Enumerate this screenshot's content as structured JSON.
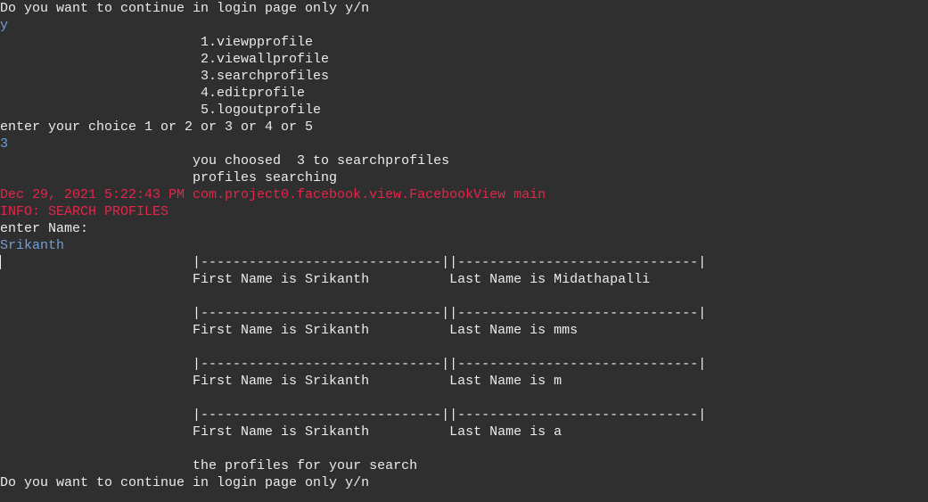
{
  "colors": {
    "background": "#2f2f2f",
    "stdout": "#ebebeb",
    "stdin": "#6f9fd8",
    "stderr": "#e4264a"
  },
  "lines": [
    {
      "text": "Do you want to continue in login page only y/n",
      "type": "out"
    },
    {
      "text": "y",
      "type": "in"
    },
    {
      "text": "                         1.viewpprofile",
      "type": "out"
    },
    {
      "text": "                         2.viewallprofile",
      "type": "out"
    },
    {
      "text": "                         3.searchprofiles",
      "type": "out"
    },
    {
      "text": "                         4.editprofile",
      "type": "out"
    },
    {
      "text": "                         5.logoutprofile",
      "type": "out"
    },
    {
      "text": "enter your choice 1 or 2 or 3 or 4 or 5",
      "type": "out"
    },
    {
      "text": "3",
      "type": "in"
    },
    {
      "text": "                        you choosed  3 to searchprofiles",
      "type": "out"
    },
    {
      "text": "                        profiles searching",
      "type": "out"
    },
    {
      "text": "Dec 29, 2021 5:22:43 PM com.project0.facebook.view.FacebookView main",
      "type": "err"
    },
    {
      "text": "INFO: SEARCH PROFILES",
      "type": "err"
    },
    {
      "text": "enter Name:",
      "type": "out"
    },
    {
      "text": "Srikanth",
      "type": "in"
    },
    {
      "text": "                        |------------------------------||------------------------------|",
      "type": "out"
    },
    {
      "text": "                        First Name is Srikanth          Last Name is Midathapalli",
      "type": "out"
    },
    {
      "text": "",
      "type": "out"
    },
    {
      "text": "                        |------------------------------||------------------------------|",
      "type": "out"
    },
    {
      "text": "                        First Name is Srikanth          Last Name is mms",
      "type": "out"
    },
    {
      "text": "",
      "type": "out"
    },
    {
      "text": "                        |------------------------------||------------------------------|",
      "type": "out"
    },
    {
      "text": "                        First Name is Srikanth          Last Name is m",
      "type": "out"
    },
    {
      "text": "",
      "type": "out"
    },
    {
      "text": "                        |------------------------------||------------------------------|",
      "type": "out"
    },
    {
      "text": "                        First Name is Srikanth          Last Name is a",
      "type": "out"
    },
    {
      "text": "",
      "type": "out"
    },
    {
      "text": "                        the profiles for your search",
      "type": "out"
    },
    {
      "text": "Do you want to continue in login page only y/n",
      "type": "out"
    }
  ]
}
